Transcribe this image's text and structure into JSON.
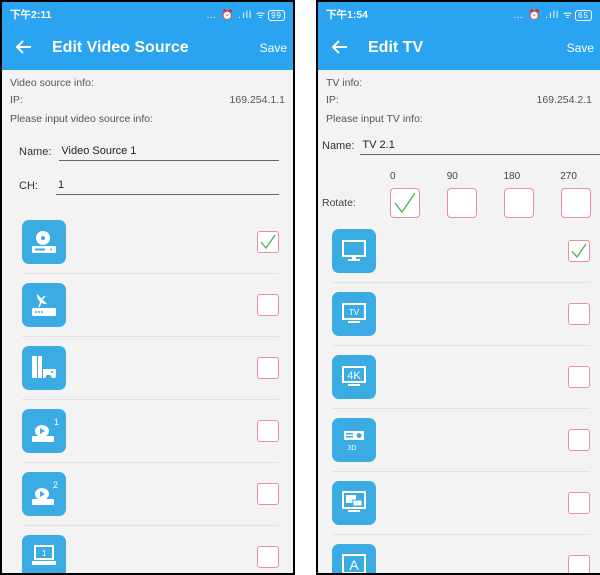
{
  "colors": {
    "primary": "#2aa3f0",
    "icon_bg": "#3aabe3",
    "check_border": "#e88da8",
    "check_mark": "#4caf50"
  },
  "left": {
    "status": {
      "time": "下午2:11",
      "icons": "… ⏰ .ıll ᯤ",
      "battery": "99"
    },
    "appbar": {
      "title": "Edit Video Source",
      "save_label": "Save"
    },
    "info_label": "Video source info:",
    "ip_label": "IP:",
    "ip_value": "169.254.1.1",
    "prompt": "Please input video source info:",
    "name_label": "Name:",
    "name_value": "Video Source 1",
    "ch_label": "CH:",
    "ch_value": "1",
    "items": [
      {
        "icon": "dvd-player-icon",
        "checked": true
      },
      {
        "icon": "satellite-receiver-icon",
        "checked": false
      },
      {
        "icon": "game-console-icon",
        "checked": false
      },
      {
        "icon": "media-player-1-icon",
        "badge": "1",
        "checked": false
      },
      {
        "icon": "media-player-2-icon",
        "badge": "2",
        "checked": false
      },
      {
        "icon": "computer-icon",
        "checked": false
      }
    ]
  },
  "right": {
    "status": {
      "time": "下午1:54",
      "icons": "… ⏰ .ıll ᯤ",
      "battery": "65"
    },
    "appbar": {
      "title": "Edit TV",
      "save_label": "Save"
    },
    "info_label": "TV info:",
    "ip_label": "IP:",
    "ip_value": "169.254.2.1",
    "prompt": "Please input TV info:",
    "name_label": "Name:",
    "name_value": "TV 2.1",
    "rotate_label": "Rotate:",
    "rotations": [
      {
        "label": "0",
        "checked": true
      },
      {
        "label": "90",
        "checked": false
      },
      {
        "label": "180",
        "checked": false
      },
      {
        "label": "270",
        "checked": false
      }
    ],
    "items": [
      {
        "icon": "monitor-icon",
        "checked": true
      },
      {
        "icon": "tv-icon",
        "text": "TV",
        "checked": false
      },
      {
        "icon": "4k-tv-icon",
        "text": "4K",
        "checked": false
      },
      {
        "icon": "3d-projector-icon",
        "text": "3D",
        "checked": false
      },
      {
        "icon": "display-window-icon",
        "checked": false
      },
      {
        "icon": "a-display-icon",
        "text": "A",
        "checked": false
      }
    ]
  }
}
